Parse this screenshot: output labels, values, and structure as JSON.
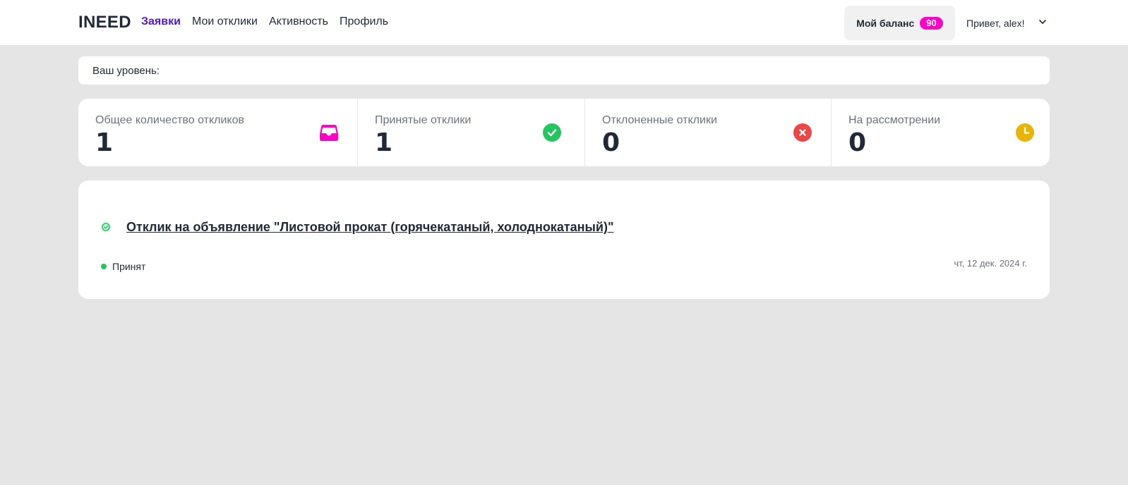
{
  "header": {
    "logo": "INEED",
    "nav": [
      {
        "label": "Заявки",
        "active": true
      },
      {
        "label": "Мои отклики",
        "active": false
      },
      {
        "label": "Активность",
        "active": false
      },
      {
        "label": "Профиль",
        "active": false
      }
    ],
    "balance_label": "Мой баланс",
    "balance_value": "90",
    "greeting": "Привет, alex!"
  },
  "level": {
    "label": "Ваш уровень:"
  },
  "stats": [
    {
      "label": "Общее количество откликов",
      "value": "1",
      "icon": "inbox-icon",
      "color": "#ff00c8"
    },
    {
      "label": "Принятые отклики",
      "value": "1",
      "icon": "check-circle-icon",
      "color": "#22c55e"
    },
    {
      "label": "Отклоненные отклики",
      "value": "0",
      "icon": "x-circle-icon",
      "color": "#ef4444"
    },
    {
      "label": "На рассмотрении",
      "value": "0",
      "icon": "clock-icon",
      "color": "#eab308"
    }
  ],
  "response": {
    "title": "Отклик на объявление \"Листовой прокат (горячекатаный, холоднокатаный)\"",
    "status": "Принят",
    "date": "чт, 12 дек. 2024 г."
  },
  "colors": {
    "accent": "#4f18d6",
    "badge": "#ff00c8",
    "background": "#e5e5e5"
  }
}
